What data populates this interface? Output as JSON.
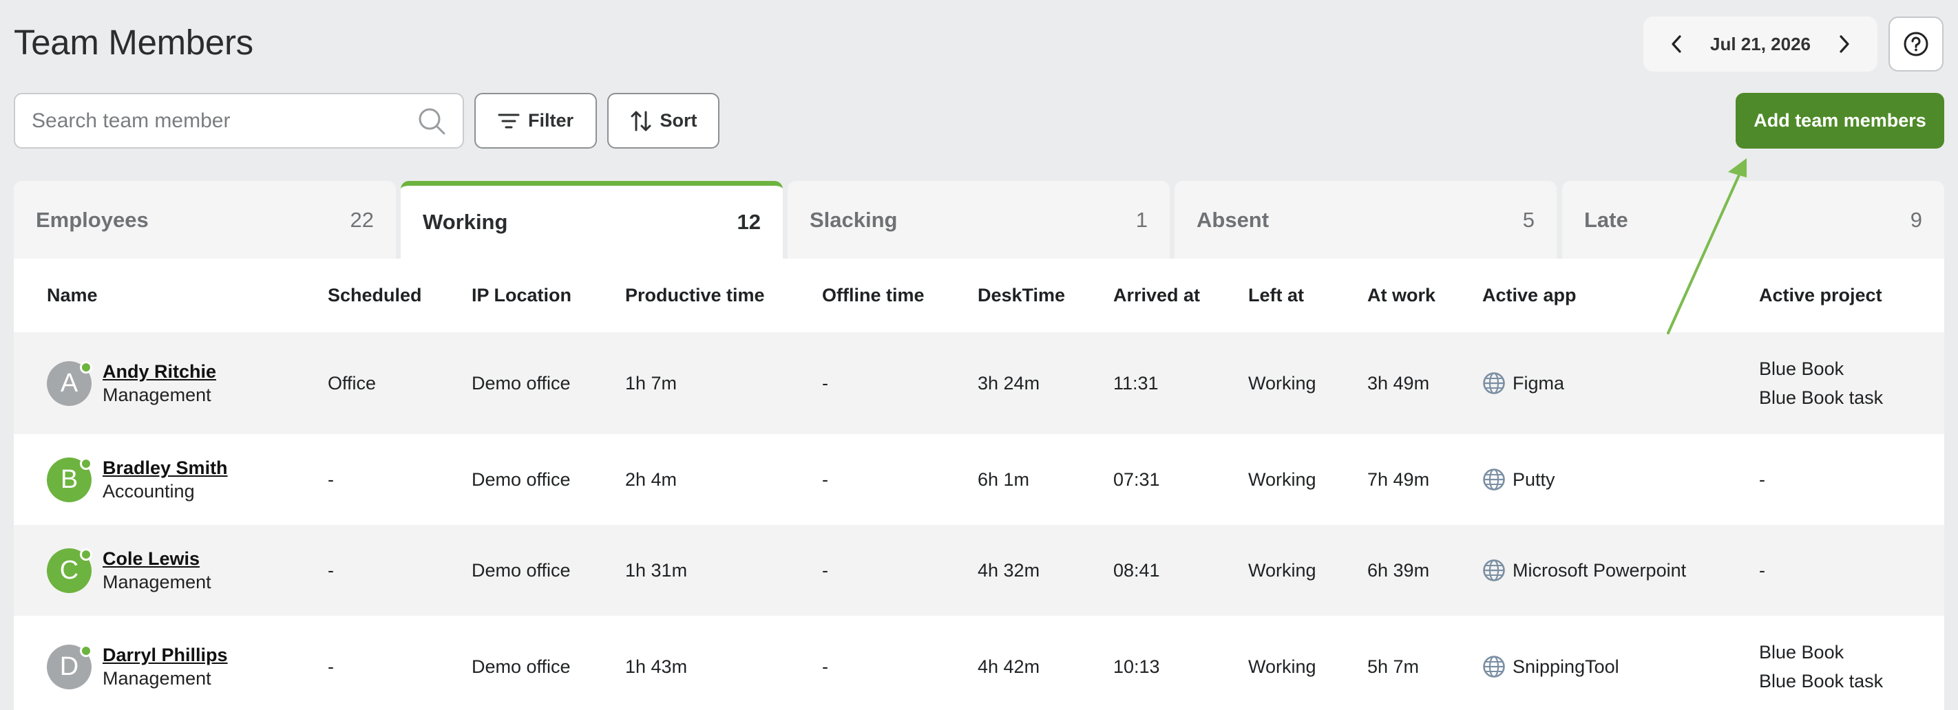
{
  "page_title": "Team Members",
  "date_nav": {
    "date": "Jul 21, 2026"
  },
  "search": {
    "placeholder": "Search team member",
    "value": ""
  },
  "toolbar": {
    "filter_label": "Filter",
    "sort_label": "Sort",
    "add_label": "Add team members"
  },
  "tabs": [
    {
      "label": "Employees",
      "count": "22"
    },
    {
      "label": "Working",
      "count": "12"
    },
    {
      "label": "Slacking",
      "count": "1"
    },
    {
      "label": "Absent",
      "count": "5"
    },
    {
      "label": "Late",
      "count": "9"
    }
  ],
  "active_tab": "Working",
  "columns": {
    "name": "Name",
    "scheduled": "Scheduled",
    "ip_location": "IP Location",
    "productive_time": "Productive time",
    "offline_time": "Offline time",
    "desktime": "DeskTime",
    "arrived_at": "Arrived at",
    "left_at": "Left at",
    "at_work": "At work",
    "active_app": "Active app",
    "active_project": "Active project"
  },
  "rows": [
    {
      "initial": "A",
      "avatar_color": "#a5a8ab",
      "name": "Andy Ritchie",
      "role": "Management",
      "scheduled": "Office",
      "ip_location": "Demo office",
      "productive_time": "1h 7m",
      "offline_time": "-",
      "desktime": "3h 24m",
      "arrived_at": "11:31",
      "left_at": "Working",
      "at_work": "3h 49m",
      "active_app": "Figma",
      "project_line1": "Blue Book",
      "project_line2": "Blue Book task"
    },
    {
      "initial": "B",
      "avatar_color": "#6db33f",
      "name": "Bradley Smith",
      "role": "Accounting",
      "scheduled": "-",
      "ip_location": "Demo office",
      "productive_time": "2h 4m",
      "offline_time": "-",
      "desktime": "6h 1m",
      "arrived_at": "07:31",
      "left_at": "Working",
      "at_work": "7h 49m",
      "active_app": "Putty",
      "project_line1": "-",
      "project_line2": ""
    },
    {
      "initial": "C",
      "avatar_color": "#6db33f",
      "name": "Cole Lewis",
      "role": "Management",
      "scheduled": "-",
      "ip_location": "Demo office",
      "productive_time": "1h 31m",
      "offline_time": "-",
      "desktime": "4h 32m",
      "arrived_at": "08:41",
      "left_at": "Working",
      "at_work": "6h 39m",
      "active_app": "Microsoft Powerpoint",
      "project_line1": "-",
      "project_line2": ""
    },
    {
      "initial": "D",
      "avatar_color": "#a5a8ab",
      "name": "Darryl Phillips",
      "role": "Management",
      "scheduled": "-",
      "ip_location": "Demo office",
      "productive_time": "1h 43m",
      "offline_time": "-",
      "desktime": "4h 42m",
      "arrived_at": "10:13",
      "left_at": "Working",
      "at_work": "5h 7m",
      "active_app": "SnippingTool",
      "project_line1": "Blue Book",
      "project_line2": "Blue Book task"
    }
  ],
  "colors": {
    "accent_green": "#6db33f",
    "button_green": "#4e8a29",
    "annotation_arrow": "#7dbb4f"
  }
}
